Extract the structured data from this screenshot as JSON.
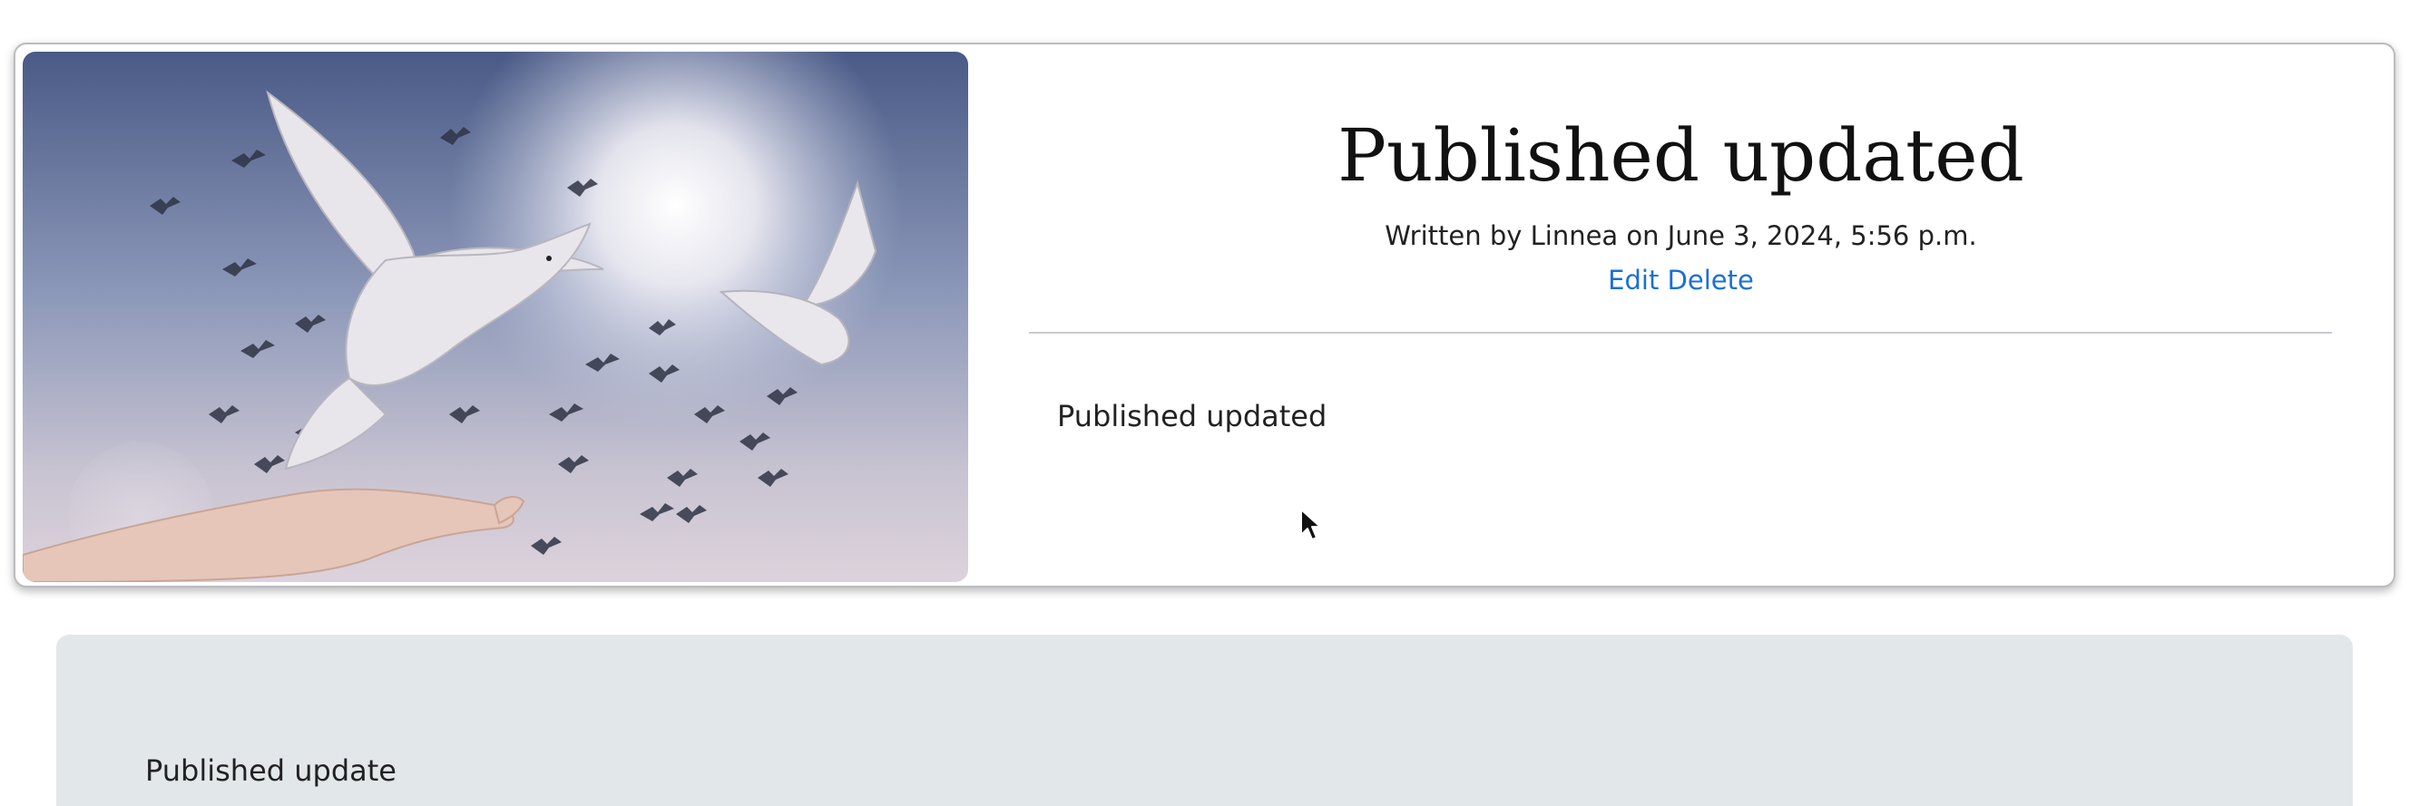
{
  "post": {
    "title": "Published updated",
    "meta": "Written by Linnea on June 3, 2024, 5:56 p.m.",
    "actions": {
      "edit_label": "Edit",
      "delete_label": "Delete"
    },
    "body": "Published updated",
    "image": {
      "subject": "doves-released-from-hand-image"
    }
  },
  "comment": {
    "text": "Published update"
  },
  "colors": {
    "link": "#1a6fd8",
    "comment_bg": "#e2e7ea",
    "card_border": "#b9bcbf"
  }
}
